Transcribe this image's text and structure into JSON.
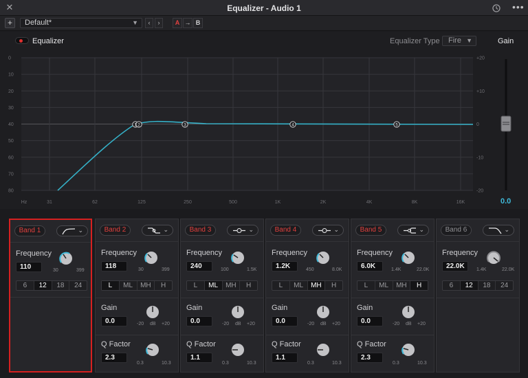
{
  "window": {
    "title": "Equalizer - Audio 1"
  },
  "preset": {
    "name": "Default*",
    "compare_a": "A",
    "compare_copy": "→",
    "compare_b": "B"
  },
  "eq": {
    "label": "Equalizer",
    "type_label": "Equalizer Type",
    "type_value": "Fire",
    "gain_label": "Gain",
    "gain_value": "0.0"
  },
  "graph": {
    "left_axis": [
      "0",
      "10",
      "20",
      "30",
      "40",
      "50",
      "60",
      "70",
      "80"
    ],
    "right_axis": [
      "+20",
      "+10",
      "0",
      "-10",
      "-20"
    ],
    "freq_axis": [
      "Hz",
      "31",
      "62",
      "125",
      "250",
      "500",
      "1K",
      "2K",
      "4K",
      "8K",
      "16K"
    ],
    "points": [
      "1",
      "2",
      "3",
      "4",
      "5"
    ]
  },
  "labels": {
    "frequency": "Frequency",
    "gain": "Gain",
    "q_factor": "Q Factor",
    "db": "dB"
  },
  "bands": [
    {
      "name": "Band 1",
      "enabled": true,
      "shape": "high-pass",
      "frequency": "110",
      "freq_min": "30",
      "freq_max": "399",
      "options": [
        "6",
        "12",
        "18",
        "24"
      ],
      "selected": "12"
    },
    {
      "name": "Band 2",
      "enabled": true,
      "shape": "low-shelf",
      "frequency": "118",
      "freq_min": "30",
      "freq_max": "399",
      "options": [
        "L",
        "ML",
        "MH",
        "H"
      ],
      "selected": "L",
      "gain": "0.0",
      "gain_min": "-20",
      "gain_max": "+20",
      "q": "2.3",
      "q_min": "0.3",
      "q_max": "10.3"
    },
    {
      "name": "Band 3",
      "enabled": true,
      "shape": "bell",
      "frequency": "240",
      "freq_min": "100",
      "freq_max": "1.5K",
      "options": [
        "L",
        "ML",
        "MH",
        "H"
      ],
      "selected": "ML",
      "gain": "0.0",
      "gain_min": "-20",
      "gain_max": "+20",
      "q": "1.1",
      "q_min": "0.3",
      "q_max": "10.3"
    },
    {
      "name": "Band 4",
      "enabled": true,
      "shape": "bell",
      "frequency": "1.2K",
      "freq_min": "450",
      "freq_max": "8.0K",
      "options": [
        "L",
        "ML",
        "MH",
        "H"
      ],
      "selected": "MH",
      "gain": "0.0",
      "gain_min": "-20",
      "gain_max": "+20",
      "q": "1.1",
      "q_min": "0.3",
      "q_max": "10.3"
    },
    {
      "name": "Band 5",
      "enabled": true,
      "shape": "high-shelf",
      "frequency": "6.0K",
      "freq_min": "1.4K",
      "freq_max": "22.0K",
      "options": [
        "L",
        "ML",
        "MH",
        "H"
      ],
      "selected": "H",
      "gain": "0.0",
      "gain_min": "-20",
      "gain_max": "+20",
      "q": "2.3",
      "q_min": "0.3",
      "q_max": "10.3"
    },
    {
      "name": "Band 6",
      "enabled": false,
      "shape": "low-pass",
      "frequency": "22.0K",
      "freq_min": "1.4K",
      "freq_max": "22.0K",
      "options": [
        "6",
        "12",
        "18",
        "24"
      ],
      "selected": "12"
    }
  ],
  "colors": {
    "accent": "#3fb9d9",
    "band_on": "#e0403d",
    "selected_border": "#d72020"
  }
}
